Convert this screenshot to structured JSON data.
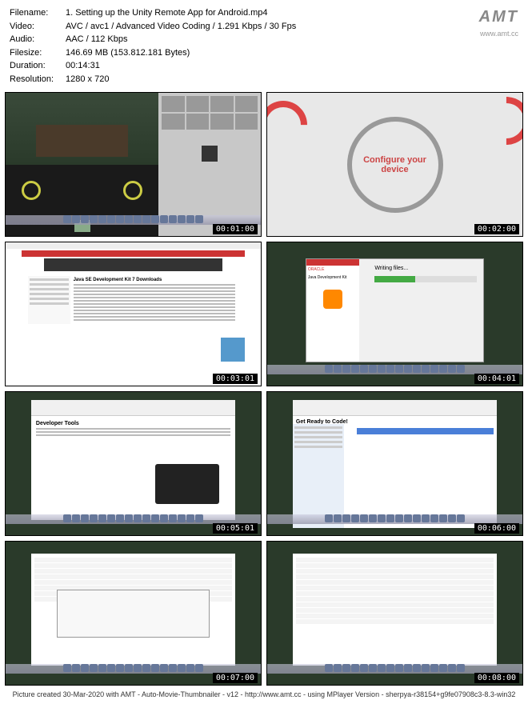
{
  "header": {
    "filename_label": "Filename:",
    "filename": "1. Setting up the Unity Remote App for Android.mp4",
    "video_label": "Video:",
    "video": "AVC / avc1 / Advanced Video Coding / 1.291 Kbps / 30 Fps",
    "audio_label": "Audio:",
    "audio": "AAC / 112 Kbps",
    "filesize_label": "Filesize:",
    "filesize": "146.69 MB (153.812.181 Bytes)",
    "duration_label": "Duration:",
    "duration": "00:14:31",
    "resolution_label": "Resolution:",
    "resolution": "1280 x 720"
  },
  "logo": {
    "text": "AMT",
    "url": "www.amt.cc"
  },
  "thumbnails": [
    {
      "timestamp": "00:01:00",
      "desc": "unity-editor-scene"
    },
    {
      "timestamp": "00:02:00",
      "desc": "configure-your-device",
      "text": "Configure your device"
    },
    {
      "timestamp": "00:03:01",
      "desc": "oracle-java-download-page",
      "title": "Java SE Development Kit 7 Downloads"
    },
    {
      "timestamp": "00:04:01",
      "desc": "java-install-dialog",
      "title": "Java Development Kit",
      "status": "Writing files..."
    },
    {
      "timestamp": "00:05:01",
      "desc": "android-developer-tools",
      "title": "Developer Tools"
    },
    {
      "timestamp": "00:06:00",
      "desc": "mac-finder-adt-bundle",
      "title": "Get Ready to Code!"
    },
    {
      "timestamp": "00:07:00",
      "desc": "android-sdk-manager-install"
    },
    {
      "timestamp": "00:08:00",
      "desc": "android-sdk-manager-packages"
    }
  ],
  "footer": "Picture created 30-Mar-2020 with AMT - Auto-Movie-Thumbnailer - v12 - http://www.amt.cc - using MPlayer Version - sherpya-r38154+g9fe07908c3-8.3-win32"
}
